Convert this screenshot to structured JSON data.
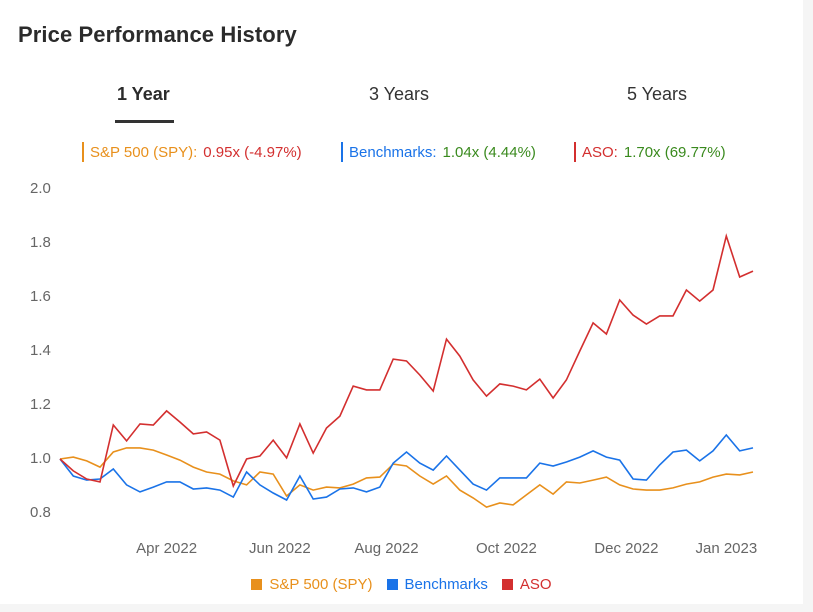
{
  "header": {
    "title": "Price Performance History"
  },
  "tabs": [
    {
      "label": "1 Year",
      "active": true
    },
    {
      "label": "3 Years",
      "active": false
    },
    {
      "label": "5 Years",
      "active": false
    }
  ],
  "summary": [
    {
      "name": "S&P 500 (SPY):",
      "value": "0.95x (-4.97%)",
      "color": "#e8901c",
      "value_color": "#d32f2f"
    },
    {
      "name": "Benchmarks:",
      "value": "1.04x (4.44%)",
      "color": "#1a73e8",
      "value_color": "#3a8a1e"
    },
    {
      "name": "ASO:",
      "value": "1.70x (69.77%)",
      "color": "#d32f2f",
      "value_color": "#3a8a1e"
    }
  ],
  "colors": {
    "spy": "#e8901c",
    "benchmarks": "#1a73e8",
    "aso": "#d32f2f"
  },
  "chart_data": {
    "type": "line",
    "title": "Price Performance History",
    "xlabel": "",
    "ylabel": "",
    "ylim": [
      0.8,
      2.0
    ],
    "yticks": [
      "2.0",
      "1.8",
      "1.6",
      "1.4",
      "1.2",
      "1.0",
      "0.8"
    ],
    "xticks": [
      {
        "label": "Apr 2022",
        "index": 8
      },
      {
        "label": "Jun 2022",
        "index": 16.5
      },
      {
        "label": "Aug 2022",
        "index": 24.5
      },
      {
        "label": "Oct 2022",
        "index": 33.5
      },
      {
        "label": "Dec 2022",
        "index": 42.5
      },
      {
        "label": "Jan 2023",
        "index": 50
      }
    ],
    "grid": false,
    "legend_position": "bottom",
    "series": [
      {
        "name": "S&P 500 (SPY)",
        "color": "#e8901c",
        "values": [
          1.0,
          1.007,
          0.993,
          0.97,
          1.026,
          1.041,
          1.041,
          1.033,
          1.015,
          0.996,
          0.97,
          0.952,
          0.944,
          0.919,
          0.904,
          0.952,
          0.944,
          0.863,
          0.904,
          0.885,
          0.896,
          0.893,
          0.907,
          0.93,
          0.933,
          0.981,
          0.974,
          0.937,
          0.907,
          0.937,
          0.885,
          0.856,
          0.822,
          0.837,
          0.83,
          0.867,
          0.904,
          0.87,
          0.915,
          0.911,
          0.922,
          0.933,
          0.904,
          0.889,
          0.885,
          0.885,
          0.893,
          0.907,
          0.915,
          0.933,
          0.944,
          0.941,
          0.952
        ]
      },
      {
        "name": "Benchmarks",
        "color": "#1a73e8",
        "values": [
          1.0,
          0.937,
          0.922,
          0.926,
          0.963,
          0.904,
          0.878,
          0.896,
          0.915,
          0.915,
          0.889,
          0.893,
          0.885,
          0.859,
          0.952,
          0.904,
          0.874,
          0.848,
          0.937,
          0.852,
          0.859,
          0.889,
          0.893,
          0.878,
          0.896,
          0.985,
          1.026,
          0.985,
          0.959,
          1.011,
          0.959,
          0.907,
          0.885,
          0.93,
          0.93,
          0.93,
          0.985,
          0.974,
          0.989,
          1.007,
          1.03,
          1.007,
          0.996,
          0.926,
          0.922,
          0.978,
          1.026,
          1.033,
          0.993,
          1.03,
          1.089,
          1.03,
          1.041
        ]
      },
      {
        "name": "ASO",
        "color": "#d32f2f",
        "values": [
          1.0,
          0.956,
          0.926,
          0.915,
          1.126,
          1.067,
          1.13,
          1.126,
          1.178,
          1.137,
          1.093,
          1.1,
          1.07,
          0.9,
          1.0,
          1.011,
          1.07,
          1.004,
          1.13,
          1.022,
          1.115,
          1.159,
          1.27,
          1.256,
          1.256,
          1.37,
          1.363,
          1.311,
          1.252,
          1.444,
          1.381,
          1.293,
          1.233,
          1.278,
          1.27,
          1.256,
          1.296,
          1.226,
          1.293,
          1.4,
          1.504,
          1.463,
          1.589,
          1.533,
          1.5,
          1.53,
          1.53,
          1.626,
          1.585,
          1.626,
          1.826,
          1.674,
          1.696
        ]
      }
    ]
  },
  "legend": [
    {
      "label": "S&P 500 (SPY)",
      "color": "#e8901c"
    },
    {
      "label": "Benchmarks",
      "color": "#1a73e8"
    },
    {
      "label": "ASO",
      "color": "#d32f2f"
    }
  ]
}
